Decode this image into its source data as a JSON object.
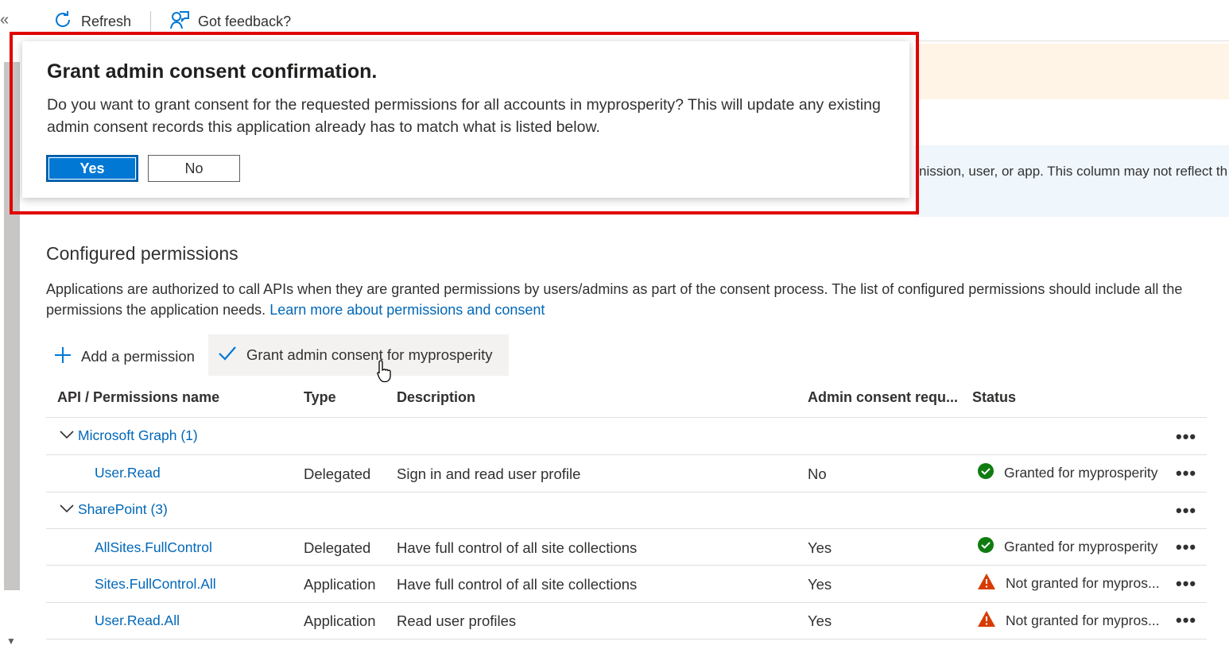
{
  "toolbar": {
    "refresh_label": "Refresh",
    "feedback_label": "Got feedback?"
  },
  "banner": {
    "info_text": "nission, user, or app. This column may not reflect th"
  },
  "dialog": {
    "title": "Grant admin consent confirmation.",
    "body": "Do you want to grant consent for the requested permissions for all accounts in myprosperity? This will update any existing admin consent records this application already has to match what is listed below.",
    "yes_label": "Yes",
    "no_label": "No"
  },
  "section": {
    "title": "Configured permissions",
    "description": "Applications are authorized to call APIs when they are granted permissions by users/admins as part of the consent process. The list of configured permissions should include all the permissions the application needs.",
    "link_text": "Learn more about permissions and consent",
    "add_permission_label": "Add a permission",
    "grant_consent_label": "Grant admin consent for myprosperity"
  },
  "table": {
    "headers": {
      "name": "API / Permissions name",
      "type": "Type",
      "description": "Description",
      "admin_consent": "Admin consent requ...",
      "status": "Status"
    },
    "groups": [
      {
        "label": "Microsoft Graph (1)",
        "rows": [
          {
            "name": "User.Read",
            "type": "Delegated",
            "description": "Sign in and read user profile",
            "admin": "No",
            "status": "Granted for myprosperity",
            "status_icon": "check-circle-icon"
          }
        ]
      },
      {
        "label": "SharePoint (3)",
        "rows": [
          {
            "name": "AllSites.FullControl",
            "type": "Delegated",
            "description": "Have full control of all site collections",
            "admin": "Yes",
            "status": "Granted for myprosperity",
            "status_icon": "check-circle-icon"
          },
          {
            "name": "Sites.FullControl.All",
            "type": "Application",
            "description": "Have full control of all site collections",
            "admin": "Yes",
            "status": "Not granted for mypros...",
            "status_icon": "warning-icon"
          },
          {
            "name": "User.Read.All",
            "type": "Application",
            "description": "Read user profiles",
            "admin": "Yes",
            "status": "Not granted for mypros...",
            "status_icon": "warning-icon"
          }
        ]
      }
    ],
    "more_actions": "•••"
  },
  "colors": {
    "accent": "#0078d4",
    "link": "#0067b8",
    "highlight_frame": "#e00000",
    "success": "#107c10",
    "warning": "#d83b01"
  }
}
